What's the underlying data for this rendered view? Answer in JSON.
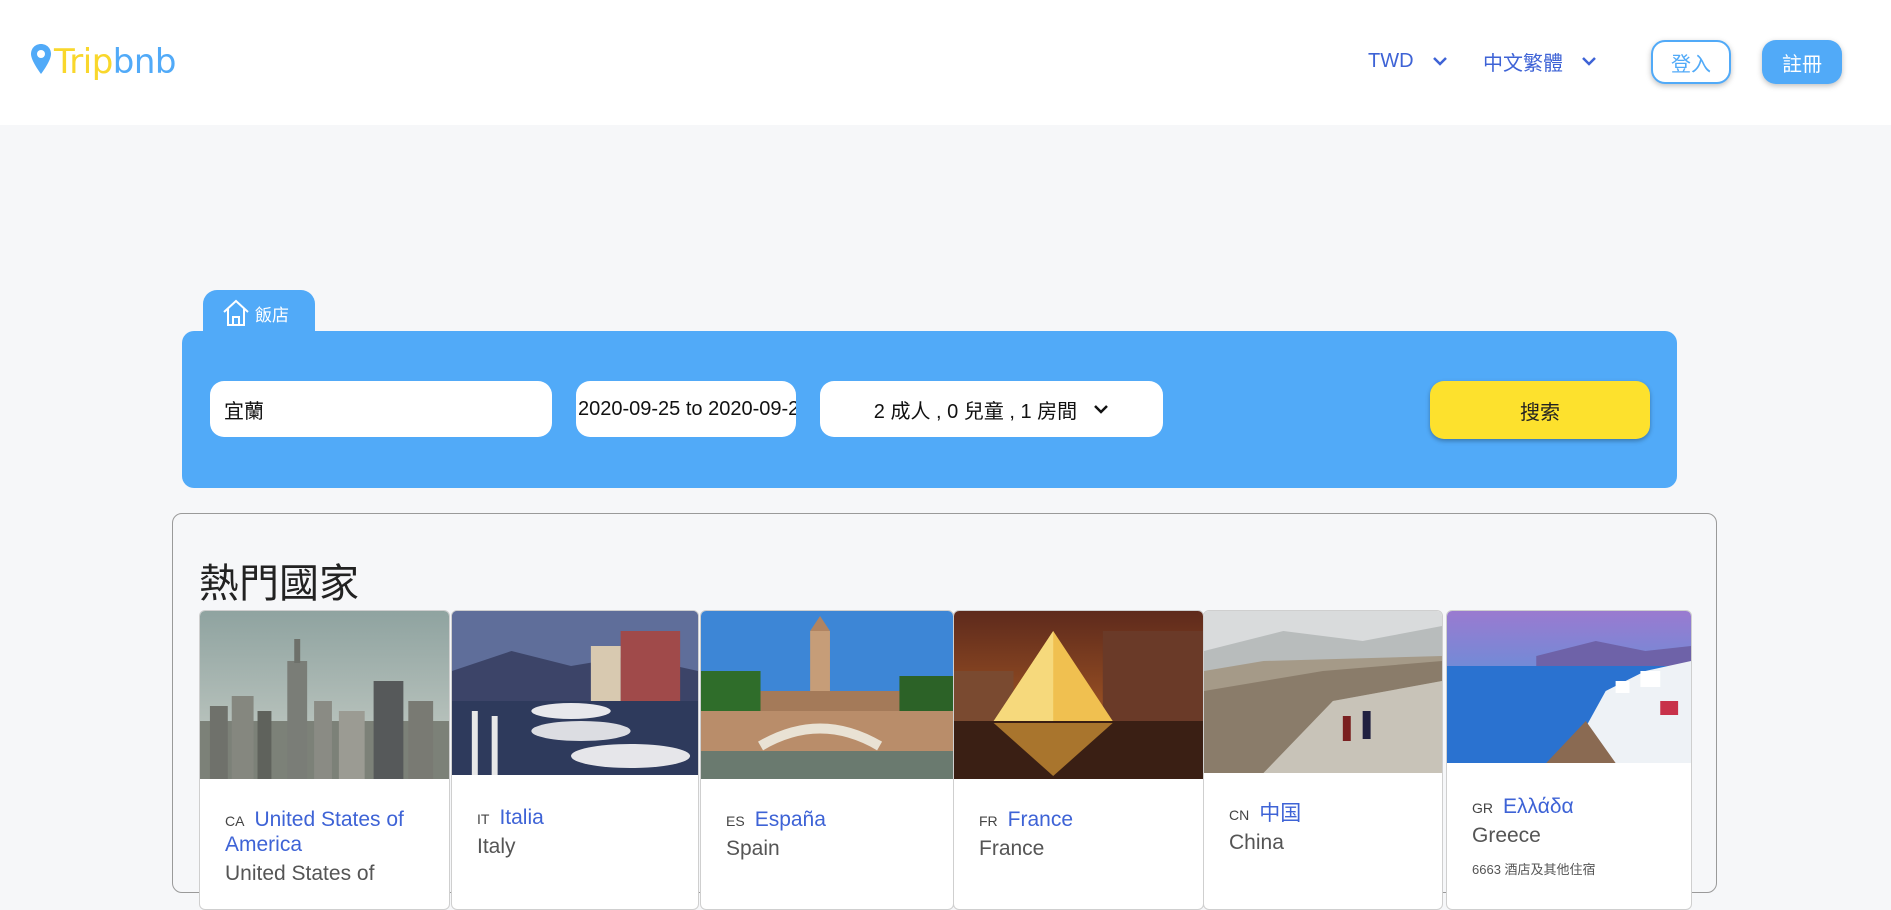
{
  "header": {
    "logo_trip": "Trip",
    "logo_bnb": "bnb",
    "currency": "TWD",
    "language": "中文繁體",
    "login_label": "登入",
    "register_label": "註冊"
  },
  "search": {
    "tab_label": "飯店",
    "location_value": "宜蘭",
    "dates_value": "2020-09-25 to 2020-09-2",
    "guests_value": "2 成人 , 0 兒童 , 1 房間",
    "search_label": "搜索"
  },
  "popular": {
    "title": "熱門國家",
    "countries": [
      {
        "code": "CA",
        "native": "United States of America",
        "english": "United States of",
        "sub": ""
      },
      {
        "code": "IT",
        "native": "Italia",
        "english": "Italy",
        "sub": ""
      },
      {
        "code": "ES",
        "native": "España",
        "english": "Spain",
        "sub": ""
      },
      {
        "code": "FR",
        "native": "France",
        "english": "France",
        "sub": ""
      },
      {
        "code": "CN",
        "native": "中国",
        "english": "China",
        "sub": ""
      },
      {
        "code": "GR",
        "native": "Ελλάδα",
        "english": "Greece",
        "sub": "6663 酒店及其他住宿"
      }
    ]
  },
  "colors": {
    "brand_blue": "#51aaf8",
    "brand_yellow": "#fde12d",
    "link_blue": "#3e63d6"
  }
}
